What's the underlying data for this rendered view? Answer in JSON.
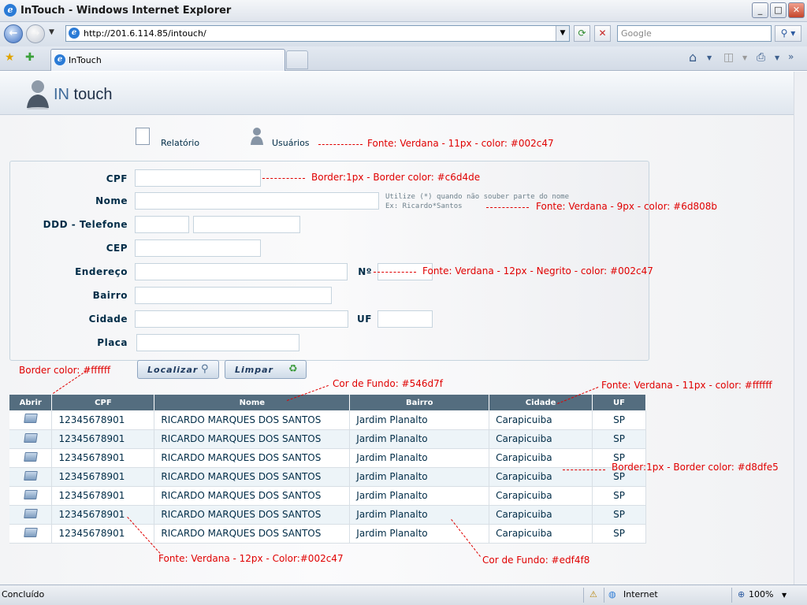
{
  "window": {
    "title": "InTouch - Windows Internet Explorer",
    "min_label": "_",
    "max_label": "□",
    "close_label": "✕"
  },
  "navbar": {
    "back_label": "←",
    "forward_label": "→",
    "url": "http://201.6.114.85/intouch/",
    "search_placeholder": "Google"
  },
  "tabs": [
    {
      "label": "InTouch"
    }
  ],
  "app": {
    "logo_prefix": "IN",
    "logo_suffix": " touch",
    "nav": [
      {
        "label": "Relatório"
      },
      {
        "label": "Usuários"
      }
    ]
  },
  "form": {
    "fields": {
      "cpf": "CPF",
      "nome": "Nome",
      "telefone": "DDD - Telefone",
      "cep": "CEP",
      "endereco": "Endereço",
      "numero": "Nº",
      "bairro": "Bairro",
      "cidade": "Cidade",
      "uf": "UF",
      "placa": "Placa"
    },
    "hint_line1": "Utilize (*) quando não souber parte do nome",
    "hint_line2": "Ex: Ricardo*Santos",
    "search_button": "Localizar",
    "clear_button": "Limpar"
  },
  "table": {
    "columns": [
      "Abrir",
      "CPF",
      "Nome",
      "Bairro",
      "Cidade",
      "UF"
    ],
    "rows": [
      {
        "cpf": "12345678901",
        "nome": "RICARDO MARQUES DOS SANTOS",
        "bairro": "Jardim Planalto",
        "cidade": "Carapicuiba",
        "uf": "SP"
      },
      {
        "cpf": "12345678901",
        "nome": "RICARDO MARQUES DOS SANTOS",
        "bairro": "Jardim Planalto",
        "cidade": "Carapicuiba",
        "uf": "SP"
      },
      {
        "cpf": "12345678901",
        "nome": "RICARDO MARQUES DOS SANTOS",
        "bairro": "Jardim Planalto",
        "cidade": "Carapicuiba",
        "uf": "SP"
      },
      {
        "cpf": "12345678901",
        "nome": "RICARDO MARQUES DOS SANTOS",
        "bairro": "Jardim Planalto",
        "cidade": "Carapicuiba",
        "uf": "SP"
      },
      {
        "cpf": "12345678901",
        "nome": "RICARDO MARQUES DOS SANTOS",
        "bairro": "Jardim Planalto",
        "cidade": "Carapicuiba",
        "uf": "SP"
      },
      {
        "cpf": "12345678901",
        "nome": "RICARDO MARQUES DOS SANTOS",
        "bairro": "Jardim Planalto",
        "cidade": "Carapicuiba",
        "uf": "SP"
      },
      {
        "cpf": "12345678901",
        "nome": "RICARDO MARQUES DOS SANTOS",
        "bairro": "Jardim Planalto",
        "cidade": "Carapicuiba",
        "uf": "SP"
      }
    ]
  },
  "annotations": {
    "nav_font": "Fonte: Verdana - 11px - color: #002c47",
    "input_border": "Border:1px - Border color: #c6d4de",
    "hint_font": "Fonte: Verdana - 9px - color: #6d808b",
    "label_font": "Fonte: Verdana - 12px - Negrito - color: #002c47",
    "header_border": "Border color: #ffffff",
    "header_bg": "Cor de Fundo: #546d7f",
    "header_font": "Fonte: Verdana - 11px - color: #ffffff",
    "cell_border": "Border:1px - Border color: #d8dfe5",
    "cell_font": "Fonte: Verdana - 12px - Color:#002c47",
    "row_bg": "Cor de Fundo: #edf4f8"
  },
  "status": {
    "text": "Concluído",
    "zone": "Internet",
    "zoom": "100%"
  },
  "colors": {
    "text": "#002c47",
    "header_bg": "#546d7f",
    "alt_row_bg": "#edf4f8",
    "input_border": "#c6d4de",
    "cell_border": "#d8dfe5",
    "hint": "#6d808b",
    "annotation": "#e00000"
  },
  "icons": [
    "ie-logo-icon",
    "back-icon",
    "forward-icon",
    "refresh-icon",
    "stop-icon",
    "search-icon",
    "favorites-star-icon",
    "add-favorites-icon",
    "home-icon",
    "feeds-icon",
    "print-icon",
    "document-icon",
    "user-icon",
    "magnifier-icon",
    "recycle-icon",
    "folder-icon",
    "globe-icon",
    "zoom-icon"
  ]
}
